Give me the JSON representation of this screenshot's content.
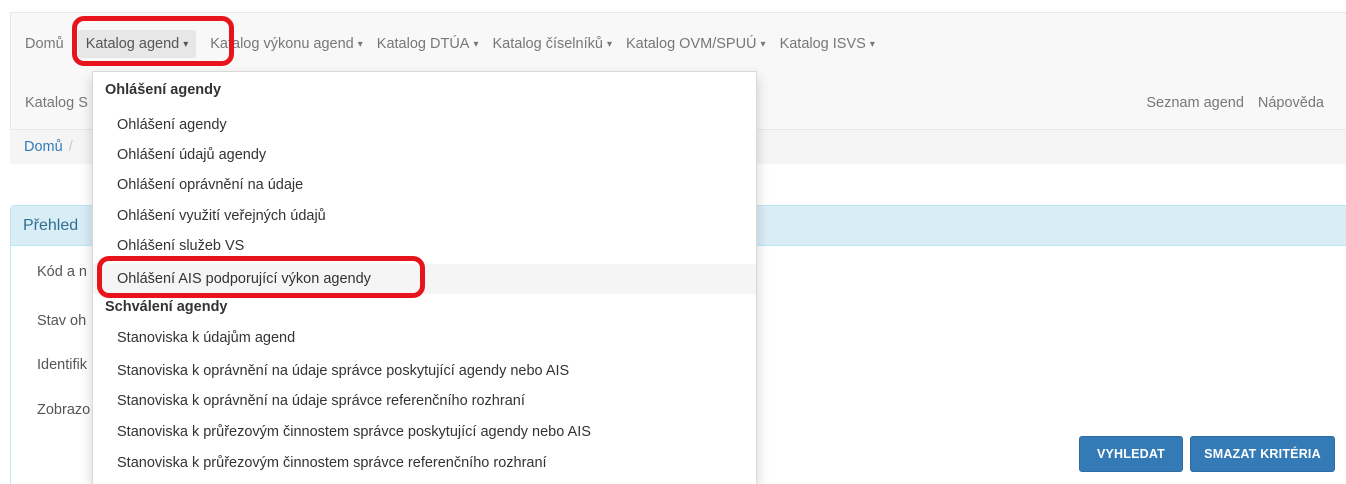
{
  "navbar": {
    "row1": [
      {
        "label": "Domů",
        "dropdown": false
      },
      {
        "label": "Katalog agend",
        "dropdown": true,
        "active": true
      },
      {
        "label": "Katalog výkonu agend",
        "dropdown": true
      },
      {
        "label": "Katalog DTÚA",
        "dropdown": true
      },
      {
        "label": "Katalog číselníků",
        "dropdown": true
      },
      {
        "label": "Katalog OVM/SPUÚ",
        "dropdown": true
      },
      {
        "label": "Katalog ISVS",
        "dropdown": true
      }
    ],
    "row2_partial": "Katalog S",
    "right_links": [
      "Seznam agend",
      "Nápověda"
    ],
    "caret_glyph": "▾"
  },
  "breadcrumb": {
    "home": "Domů",
    "separator": "/"
  },
  "panel": {
    "heading_partial": "Přehled",
    "labels_partial": [
      "Kód a n",
      "Stav oh",
      "Identifik",
      "Zobrazo"
    ],
    "search_button": "VYHLEDAT",
    "clear_button": "SMAZAT KRITÉRIA"
  },
  "dropdown": {
    "section1_header": "Ohlášení agendy",
    "section1_items": [
      "Ohlášení agendy",
      "Ohlášení údajů agendy",
      "Ohlášení oprávnění na údaje",
      "Ohlášení využití veřejných údajů",
      "Ohlášení služeb VS",
      "Ohlášení AIS podporující výkon agendy"
    ],
    "section2_header": "Schválení agendy",
    "section2_items": [
      "Stanoviska k údajům agend",
      "Stanoviska k oprávnění na údaje správce poskytující agendy nebo AIS",
      "Stanoviska k oprávnění na údaje správce referenčního rozhraní",
      "Stanoviska k průřezovým činnostem správce poskytující agendy nebo AIS",
      "Stanoviska k průřezovým činnostem správce referenčního rozhraní"
    ]
  },
  "colors": {
    "highlight": "#e8141c",
    "primary": "#337ab7",
    "panel_heading_bg": "#d9edf7",
    "navbar_bg": "#f8f8f8"
  }
}
